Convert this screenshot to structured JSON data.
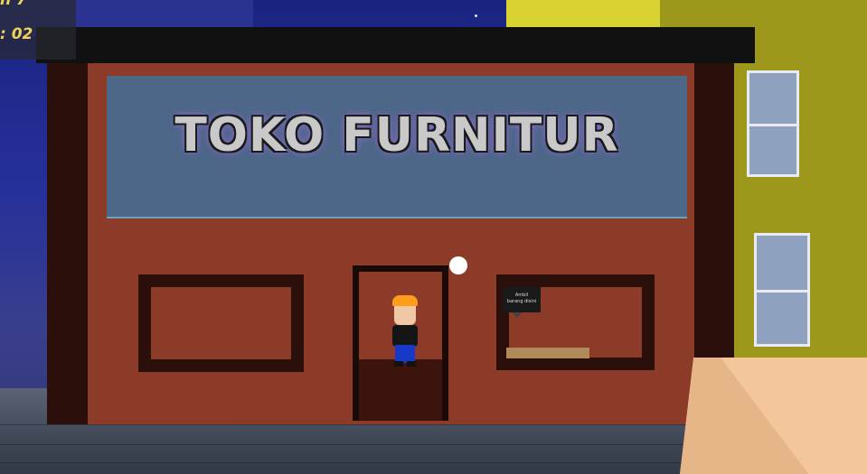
{
  "hud": {
    "line1": "n 7",
    "line2": ": 02"
  },
  "store": {
    "sign_text": "TOKO FURNITUR"
  },
  "tooltip": {
    "text": "Ambil\nbarang disini"
  },
  "colors": {
    "sky": "#1a2480",
    "store_wall": "#8d3b29",
    "sign_bg": "#4d6788",
    "hud_text": "#f0d45a",
    "building_yellow": "#a8a01a"
  },
  "icons": {
    "crosshair": "crosshair-dot"
  }
}
